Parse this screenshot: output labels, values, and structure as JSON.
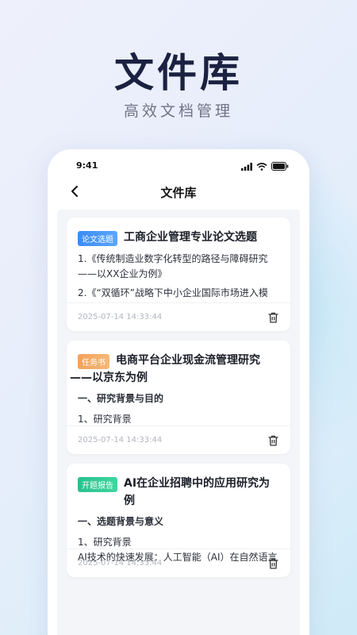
{
  "hero": {
    "title": "文件库",
    "subtitle": "高效文档管理"
  },
  "status_bar": {
    "time": "9:41"
  },
  "nav": {
    "title": "文件库"
  },
  "cards": [
    {
      "tag": "论文选题",
      "title": "工商企业管理专业论文选题",
      "lines": [
        "1.《传统制造业数字化转型的路径与障碍研究",
        "——以XX企业为例》",
        "2.《“双循环”战略下中小企业国际市场进入模"
      ],
      "time": "2025-07-14  14:33:44"
    },
    {
      "tag": "任务书",
      "title_line1": "电商平台企业现金流管理研究",
      "title_line2": "——以京东为例",
      "lines": [
        "一、研究背景与目的",
        "1、研究背景"
      ],
      "time": "2025-07-14  14:33:44"
    },
    {
      "tag": "开题报告",
      "title": "AI在企业招聘中的应用研究为例",
      "lines": [
        "一、选题背景与意义",
        "1、研究背景",
        "AI技术的快速发展：人工智能（AI）在自然语言"
      ],
      "time": "2025-07-14  14:33:44"
    }
  ],
  "colors": {
    "tag_blue": "#3a8bf5",
    "tag_orange": "#f3a25a",
    "tag_green": "#28c08c",
    "title": "#1b2140"
  },
  "icons": {
    "back": "chevron-left-icon",
    "delete": "trash-icon",
    "signal": "signal-icon",
    "wifi": "wifi-icon",
    "battery": "battery-icon"
  }
}
